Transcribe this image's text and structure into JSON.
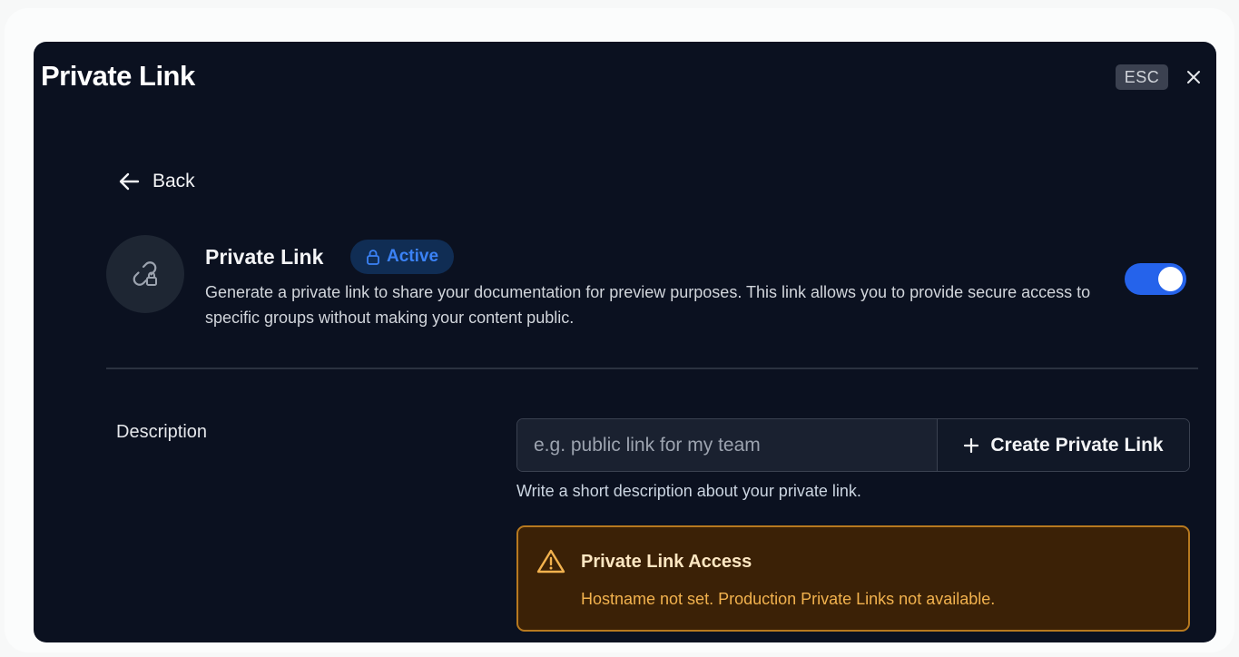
{
  "modal": {
    "title": "Private Link",
    "esc_label": "ESC",
    "close_icon": "close-icon"
  },
  "nav": {
    "back_label": "Back",
    "back_icon": "arrow-left-icon"
  },
  "feature": {
    "icon": "link-lock-icon",
    "title": "Private Link",
    "status": {
      "label": "Active",
      "icon": "lock-icon"
    },
    "description": "Generate a private link to share your documentation for preview purposes. This link allows you to provide secure access to specific groups without making your content public.",
    "enabled": true
  },
  "form": {
    "description_label": "Description",
    "description_value": "",
    "description_placeholder": "e.g. public link for my team",
    "create_button_label": "Create Private Link",
    "create_icon": "plus-icon",
    "helper_text": "Write a short description about your private link."
  },
  "alert": {
    "icon": "warning-triangle-icon",
    "title": "Private Link Access",
    "message": "Hostname not set. Production Private Links not available."
  },
  "colors": {
    "modal_bg": "#0b1120",
    "accent": "#2563eb",
    "badge_text": "#3b82f6",
    "warning_border": "#b7791f",
    "warning_bg": "#3b2106",
    "warning_text": "#f2b24e"
  }
}
